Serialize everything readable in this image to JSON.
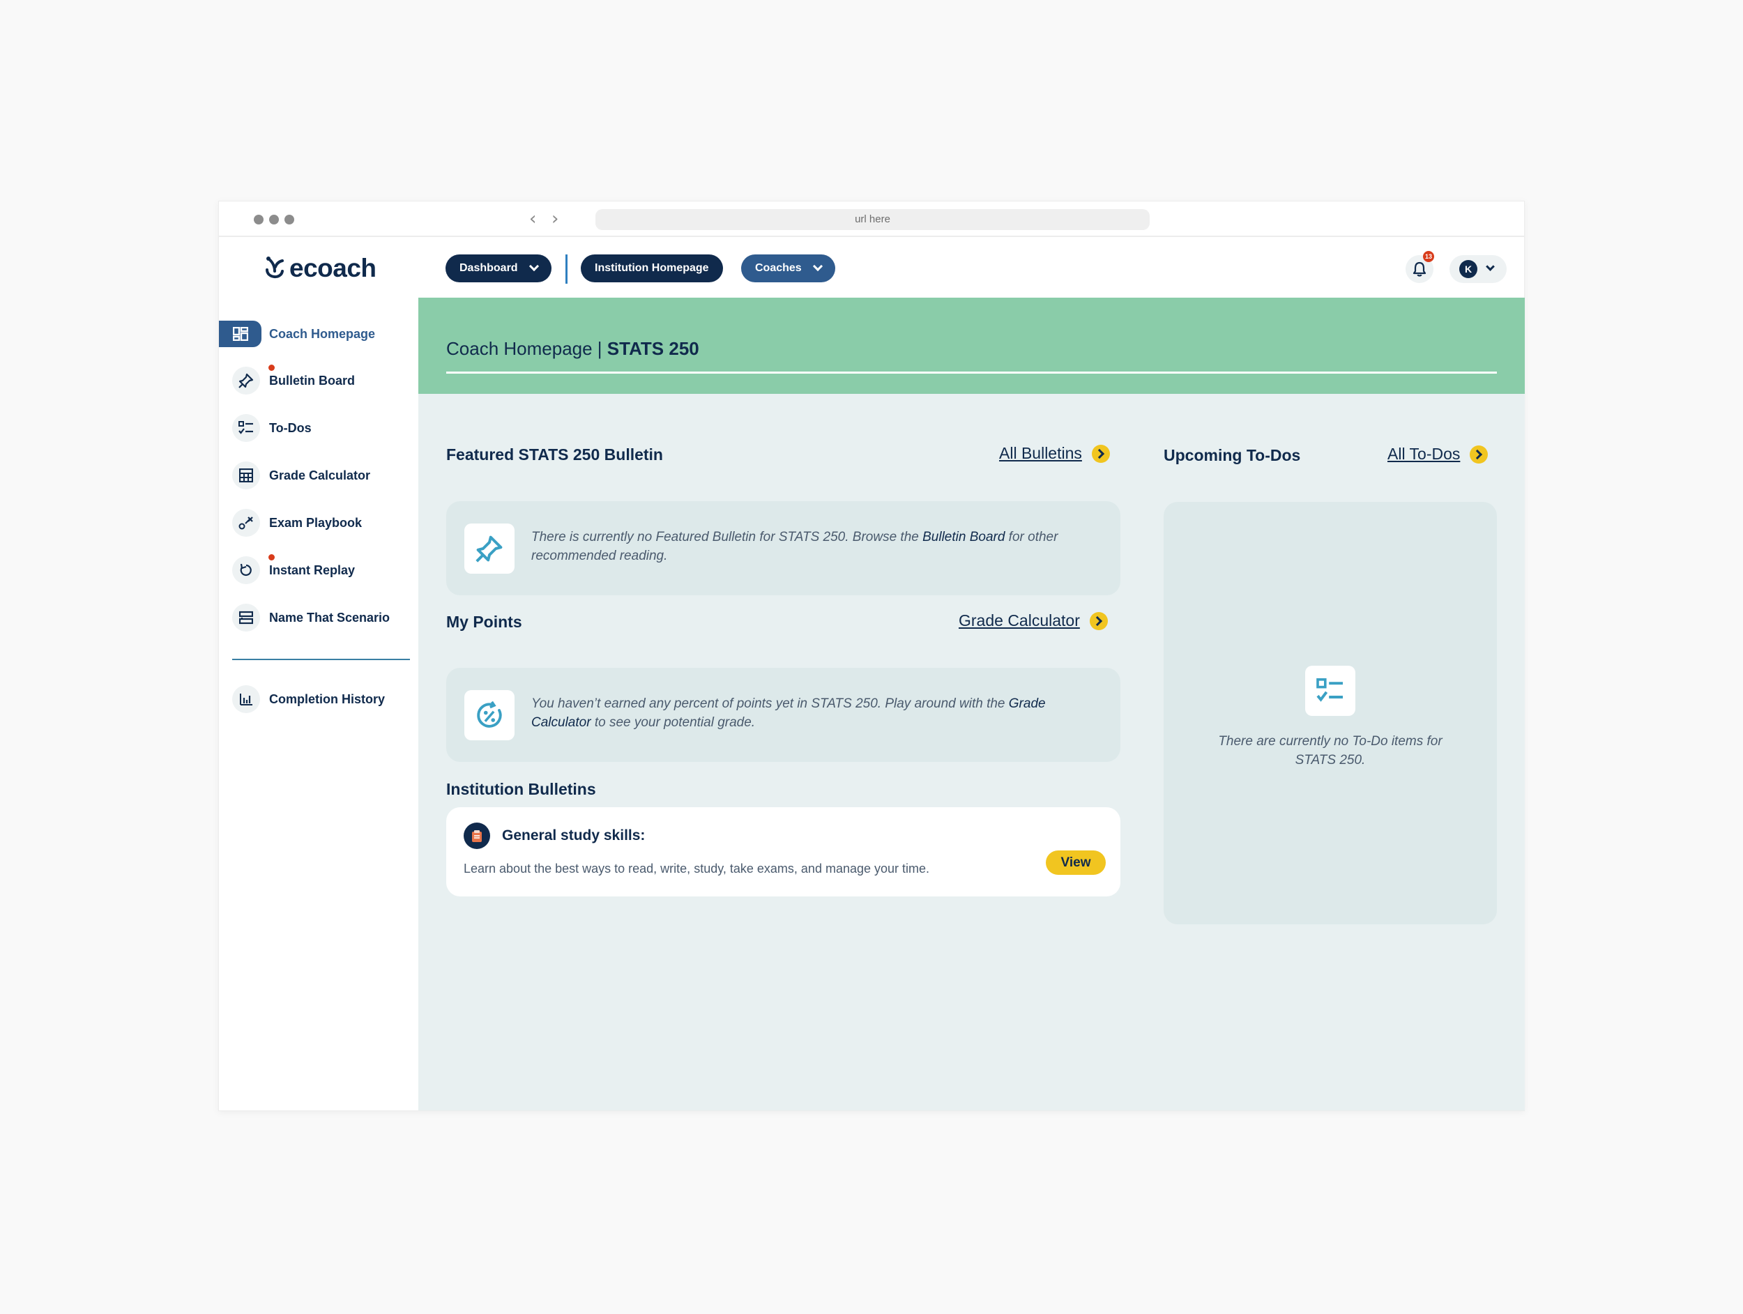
{
  "browser": {
    "url": "url here"
  },
  "header": {
    "logo_text": "ecoach",
    "nav": {
      "dashboard": "Dashboard",
      "institution_homepage": "Institution Homepage",
      "coaches": "Coaches"
    },
    "notifications_count": "13",
    "avatar_initial": "K"
  },
  "sidebar": {
    "items": [
      {
        "label": "Coach Homepage"
      },
      {
        "label": "Bulletin Board"
      },
      {
        "label": "To-Dos"
      },
      {
        "label": "Grade Calculator"
      },
      {
        "label": "Exam Playbook"
      },
      {
        "label": "Instant Replay"
      },
      {
        "label": "Name That Scenario"
      }
    ],
    "history_label": "Completion History"
  },
  "banner": {
    "title": "Coach Homepage",
    "separator": " | ",
    "course": "STATS 250"
  },
  "featured": {
    "title": "Featured STATS 250 Bulletin",
    "link": "All Bulletins",
    "text_before": "There is currently no Featured Bulletin for STATS 250. Browse the ",
    "text_bold": "Bulletin Board",
    "text_after": " for other recommended reading."
  },
  "points": {
    "title": "My Points",
    "link": "Grade Calculator",
    "text_before": "You haven’t earned any percent of points yet in STATS 250. Play around with the ",
    "text_bold": "Grade Calculator",
    "text_after": " to see your potential grade."
  },
  "institution": {
    "title": "Institution Bulletins",
    "bulletin_title": "General study skills:",
    "bulletin_desc": "Learn about the best ways to read, write, study, take exams, and manage your time.",
    "view_label": "View"
  },
  "todos": {
    "title": "Upcoming To-Dos",
    "link": "All To-Dos",
    "empty_text": "There are currently no To-Do items for STATS 250."
  },
  "colors": {
    "navy": "#102a4c",
    "blue": "#2f5b8e",
    "banner_green": "#8acca9",
    "accent_yellow": "#f1c520",
    "notification_red": "#d83c1b",
    "icon_teal": "#3aa0c4",
    "main_bg": "#e8f0f1"
  },
  "icons": {
    "logo": "sprout-icon",
    "bell": "bell-icon",
    "pin": "pushpin-icon",
    "percent": "percent-icon",
    "todo": "checklist-icon"
  }
}
